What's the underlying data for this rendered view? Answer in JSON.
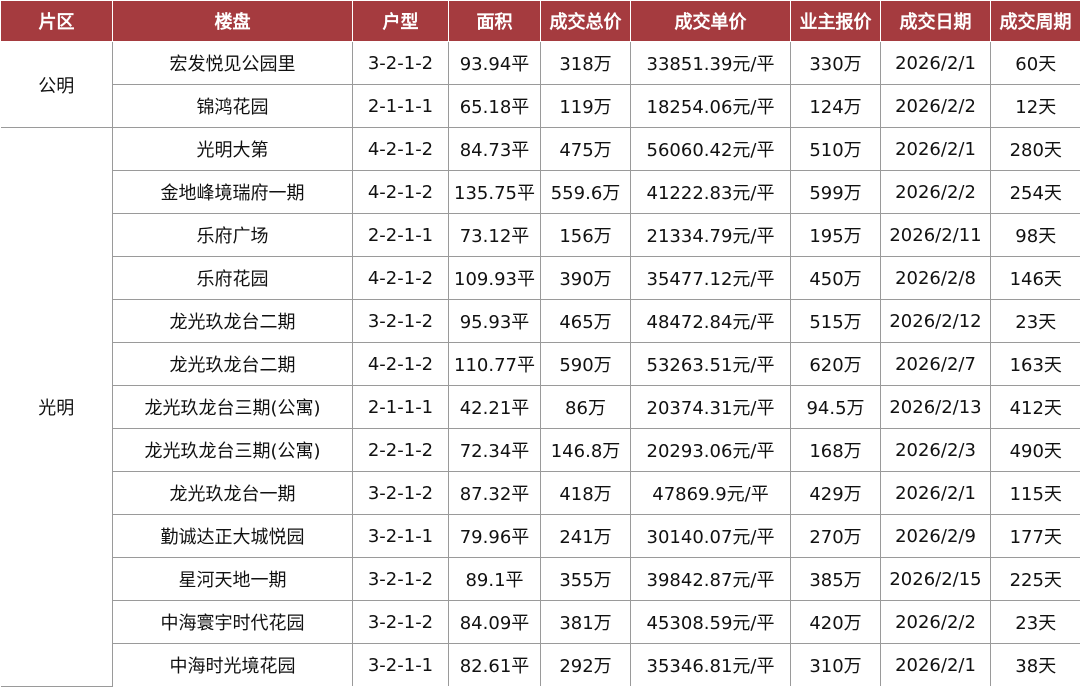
{
  "header": {
    "district": "片区",
    "estate": "楼盘",
    "layout": "户型",
    "area": "面积",
    "total_price": "成交总价",
    "unit_price": "成交单价",
    "asking_price": "业主报价",
    "deal_date": "成交日期",
    "deal_cycle": "成交周期"
  },
  "regions": [
    "公明",
    "光明"
  ],
  "rows": [
    {
      "estate": "宏发悦见公园里",
      "layout": "3-2-1-2",
      "area": "93.94平",
      "total": "318万",
      "unit": "33851.39元/平",
      "asking": "330万",
      "date": "2026/2/1",
      "cycle": "60天"
    },
    {
      "estate": "锦鸿花园",
      "layout": "2-1-1-1",
      "area": "65.18平",
      "total": "119万",
      "unit": "18254.06元/平",
      "asking": "124万",
      "date": "2026/2/2",
      "cycle": "12天"
    },
    {
      "estate": "光明大第",
      "layout": "4-2-1-2",
      "area": "84.73平",
      "total": "475万",
      "unit": "56060.42元/平",
      "asking": "510万",
      "date": "2026/2/1",
      "cycle": "280天"
    },
    {
      "estate": "金地峰境瑞府一期",
      "layout": "4-2-1-2",
      "area": "135.75平",
      "total": "559.6万",
      "unit": "41222.83元/平",
      "asking": "599万",
      "date": "2026/2/2",
      "cycle": "254天"
    },
    {
      "estate": "乐府广场",
      "layout": "2-2-1-1",
      "area": "73.12平",
      "total": "156万",
      "unit": "21334.79元/平",
      "asking": "195万",
      "date": "2026/2/11",
      "cycle": "98天"
    },
    {
      "estate": "乐府花园",
      "layout": "4-2-1-2",
      "area": "109.93平",
      "total": "390万",
      "unit": "35477.12元/平",
      "asking": "450万",
      "date": "2026/2/8",
      "cycle": "146天"
    },
    {
      "estate": "龙光玖龙台二期",
      "layout": "3-2-1-2",
      "area": "95.93平",
      "total": "465万",
      "unit": "48472.84元/平",
      "asking": "515万",
      "date": "2026/2/12",
      "cycle": "23天"
    },
    {
      "estate": "龙光玖龙台二期",
      "layout": "4-2-1-2",
      "area": "110.77平",
      "total": "590万",
      "unit": "53263.51元/平",
      "asking": "620万",
      "date": "2026/2/7",
      "cycle": "163天"
    },
    {
      "estate": "龙光玖龙台三期(公寓)",
      "layout": "2-1-1-1",
      "area": "42.21平",
      "total": "86万",
      "unit": "20374.31元/平",
      "asking": "94.5万",
      "date": "2026/2/13",
      "cycle": "412天"
    },
    {
      "estate": "龙光玖龙台三期(公寓)",
      "layout": "2-2-1-2",
      "area": "72.34平",
      "total": "146.8万",
      "unit": "20293.06元/平",
      "asking": "168万",
      "date": "2026/2/3",
      "cycle": "490天"
    },
    {
      "estate": "龙光玖龙台一期",
      "layout": "3-2-1-2",
      "area": "87.32平",
      "total": "418万",
      "unit": "47869.9元/平",
      "asking": "429万",
      "date": "2026/2/1",
      "cycle": "115天"
    },
    {
      "estate": "勤诚达正大城悦园",
      "layout": "3-2-1-1",
      "area": "79.96平",
      "total": "241万",
      "unit": "30140.07元/平",
      "asking": "270万",
      "date": "2026/2/9",
      "cycle": "177天"
    },
    {
      "estate": "星河天地一期",
      "layout": "3-2-1-2",
      "area": "89.1平",
      "total": "355万",
      "unit": "39842.87元/平",
      "asking": "385万",
      "date": "2026/2/15",
      "cycle": "225天"
    },
    {
      "estate": "中海寰宇时代花园",
      "layout": "3-2-1-2",
      "area": "84.09平",
      "total": "381万",
      "unit": "45308.59元/平",
      "asking": "420万",
      "date": "2026/2/2",
      "cycle": "23天"
    },
    {
      "estate": "中海时光境花园",
      "layout": "3-2-1-1",
      "area": "82.61平",
      "total": "292万",
      "unit": "35346.81元/平",
      "asking": "310万",
      "date": "2026/2/1",
      "cycle": "38天"
    }
  ]
}
